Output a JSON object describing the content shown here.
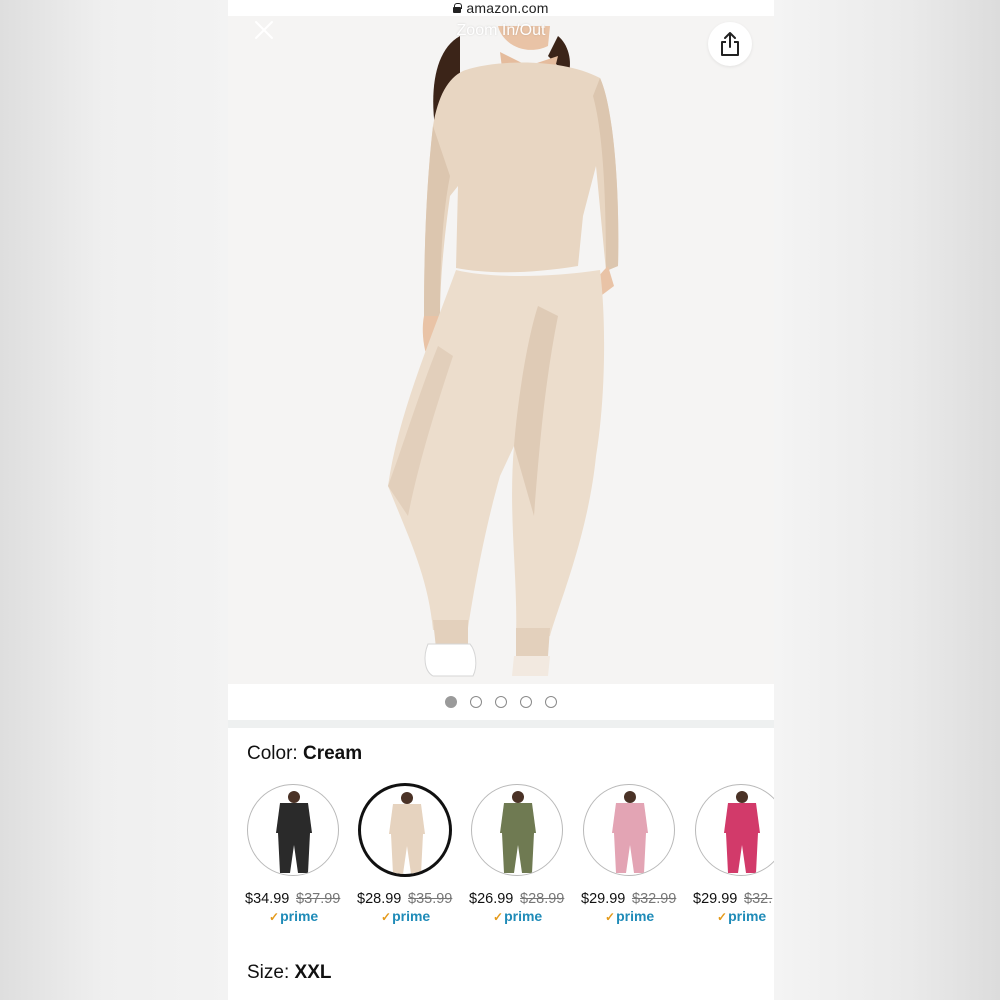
{
  "browser": {
    "domain": "amazon.com"
  },
  "viewer": {
    "title": "Zoom In/Out",
    "active_image": 1,
    "image_count": 5
  },
  "icons": {
    "close": "close-icon",
    "share": "share-icon",
    "lock": "lock-icon"
  },
  "color_selector": {
    "label": "Color:",
    "selected_value": "Cream",
    "options": [
      {
        "name": "Black",
        "price": "$34.99",
        "list_price": "$37.99",
        "prime": "prime",
        "swatch_color": "#2a2a2a"
      },
      {
        "name": "Cream",
        "price": "$28.99",
        "list_price": "$35.99",
        "prime": "prime",
        "swatch_color": "#e6d3bf",
        "selected": true
      },
      {
        "name": "Green",
        "price": "$26.99",
        "list_price": "$28.99",
        "prime": "prime",
        "swatch_color": "#6f7a52"
      },
      {
        "name": "Pink",
        "price": "$29.99",
        "list_price": "$32.99",
        "prime": "prime",
        "swatch_color": "#e3a4b4"
      },
      {
        "name": "Rose",
        "price": "$29.99",
        "list_price": "$32.",
        "prime": "prime",
        "swatch_color": "#d23a6a"
      }
    ]
  },
  "size_selector": {
    "label": "Size:",
    "selected_value": "XXL"
  },
  "colors": {
    "prime_blue": "#1f8bb8",
    "prime_check": "#e49a1b",
    "outfit": "#e8d6c2"
  }
}
